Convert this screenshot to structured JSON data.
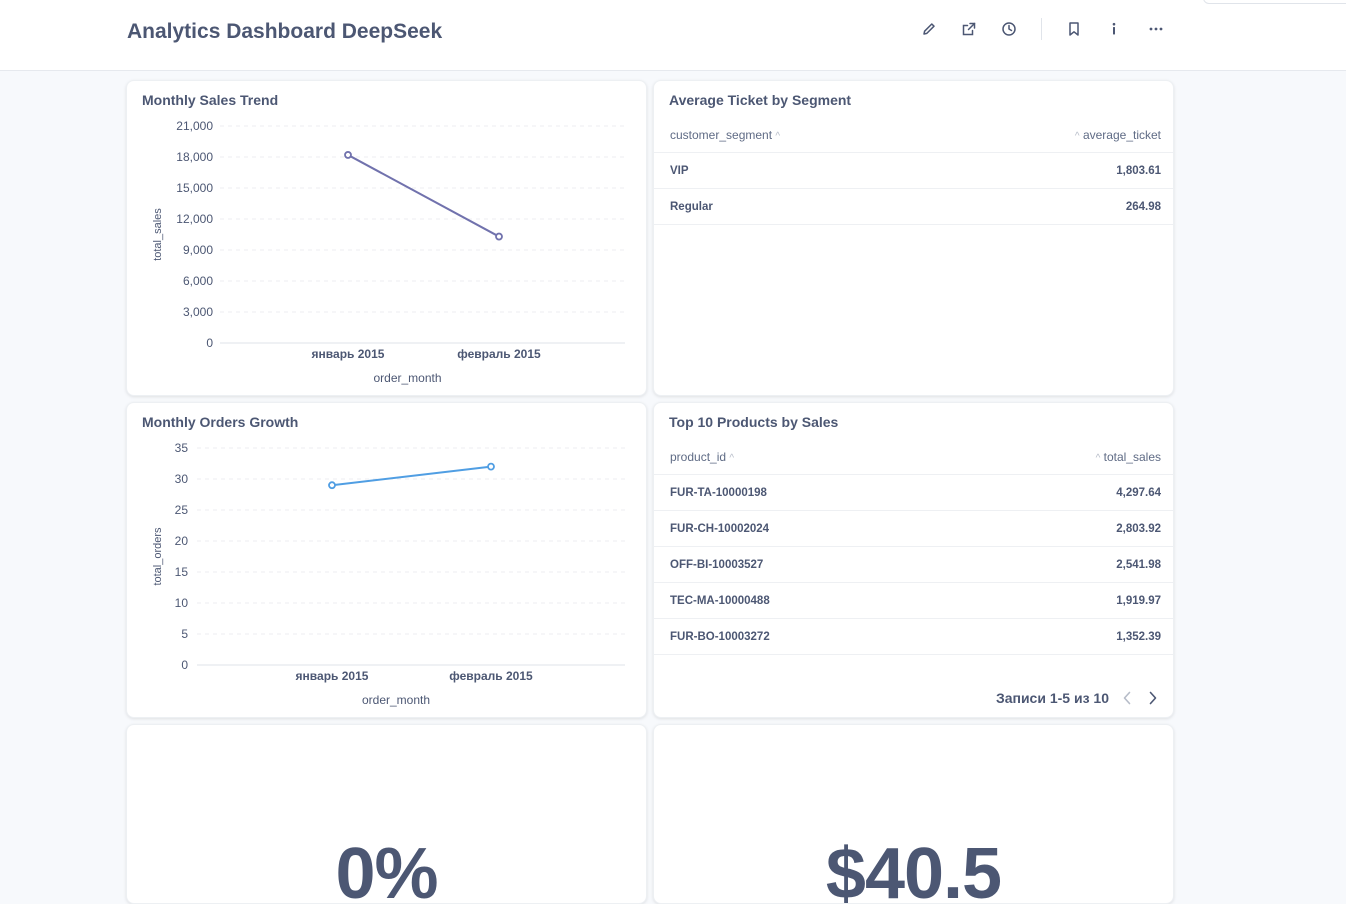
{
  "header": {
    "title": "Analytics Dashboard DeepSeek",
    "icons": [
      "pencil-icon",
      "share-icon",
      "clock-icon",
      "bookmark-icon",
      "info-icon",
      "more-icon"
    ]
  },
  "colors": {
    "sales_line": "#7172ad",
    "orders_line": "#509ee3",
    "text": "#4c5773",
    "background": "#f7f9fc"
  },
  "cards": {
    "sales_trend": {
      "title": "Monthly Sales Trend"
    },
    "avg_ticket": {
      "title": "Average Ticket by Segment",
      "columns": [
        "customer_segment",
        "average_ticket"
      ],
      "rows": [
        [
          "VIP",
          "1,803.61"
        ],
        [
          "Regular",
          "264.98"
        ]
      ]
    },
    "orders_growth": {
      "title": "Monthly Orders Growth"
    },
    "top_products": {
      "title": "Top 10 Products by Sales",
      "columns": [
        "product_id",
        "total_sales"
      ],
      "rows": [
        [
          "FUR-TA-10000198",
          "4,297.64"
        ],
        [
          "FUR-CH-10002024",
          "2,803.92"
        ],
        [
          "OFF-BI-10003527",
          "2,541.98"
        ],
        [
          "TEC-MA-10000488",
          "1,919.97"
        ],
        [
          "FUR-BO-10003272",
          "1,352.39"
        ]
      ],
      "pagination": "Записи 1-5 из 10"
    },
    "kpi_left": {
      "value": "0%"
    },
    "kpi_right": {
      "value": "$40.5"
    }
  },
  "chart_data": [
    {
      "type": "line",
      "title": "Monthly Sales Trend",
      "xlabel": "order_month",
      "ylabel": "total_sales",
      "categories": [
        "январь 2015",
        "февраль 2015"
      ],
      "series": [
        {
          "values": [
            18200,
            10300
          ]
        }
      ],
      "ylim": [
        0,
        21000
      ],
      "yticks": [
        "0",
        "3,000",
        "6,000",
        "9,000",
        "12,000",
        "15,000",
        "18,000",
        "21,000"
      ],
      "grid": true
    },
    {
      "type": "line",
      "title": "Monthly Orders Growth",
      "xlabel": "order_month",
      "ylabel": "total_orders",
      "categories": [
        "январь 2015",
        "февраль 2015"
      ],
      "series": [
        {
          "values": [
            29,
            32
          ]
        }
      ],
      "ylim": [
        0,
        35
      ],
      "yticks": [
        "0",
        "5",
        "10",
        "15",
        "20",
        "25",
        "30",
        "35"
      ],
      "grid": true
    }
  ]
}
